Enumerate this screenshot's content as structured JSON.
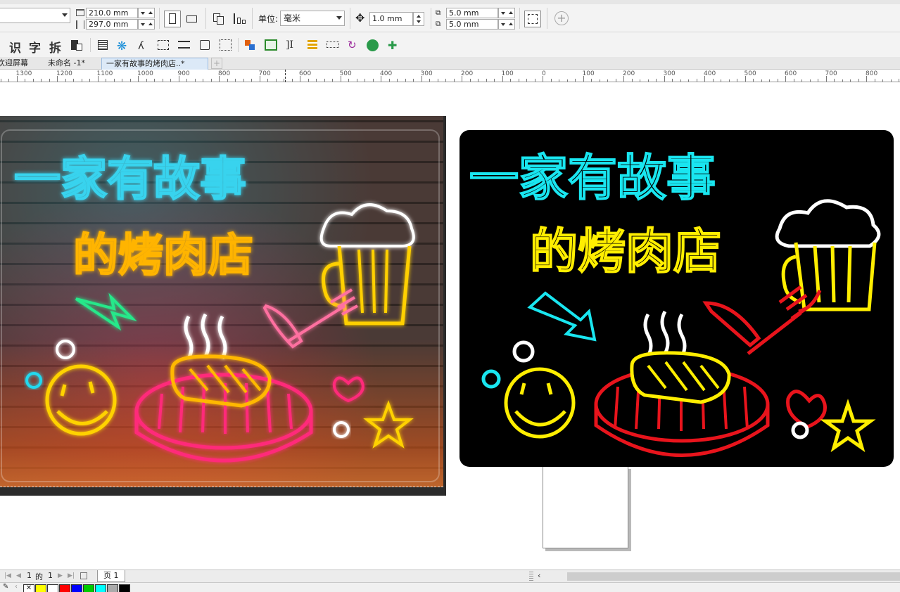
{
  "property_bar": {
    "width_value": "210.0 mm",
    "height_value": "297.0 mm",
    "unit_label": "单位:",
    "unit_value": "毫米",
    "nudge_value": "1.0 mm",
    "dup_x_value": "5.0 mm",
    "dup_y_value": "5.0 mm"
  },
  "toolbar2": {
    "glyph_1": "识",
    "glyph_2": "字",
    "glyph_3": "拆"
  },
  "tabs": [
    {
      "label": "欢迎屏幕"
    },
    {
      "label": "未命名 -1*"
    },
    {
      "label": "一家有故事的烤肉店..*"
    }
  ],
  "ruler": {
    "labels": [
      "1300",
      "1200",
      "1100",
      "1000",
      "900",
      "800",
      "700",
      "600",
      "500",
      "400",
      "300",
      "200",
      "100",
      "0",
      "100",
      "200",
      "300",
      "400",
      "500",
      "600",
      "700",
      "800"
    ]
  },
  "artwork": {
    "photo_line1": "一家有故事",
    "photo_line2": "的烤肉店",
    "vector_line1": "一家有故事",
    "vector_line2": "的烤肉店"
  },
  "page_nav": {
    "current": "1",
    "of_label": "的",
    "total": "1",
    "page_tab": "页 1"
  },
  "palette": {
    "colors": [
      "#ffff00",
      "#ffffff",
      "#ff0000",
      "#0000ff",
      "#00cc00",
      "#00ffff",
      "#aaaaaa",
      "#000000"
    ]
  },
  "colors": {
    "neon_cyan": "#19e6f0",
    "neon_yellow": "#ffee00",
    "neon_red": "#e8141c",
    "neon_white": "#ffffff"
  }
}
